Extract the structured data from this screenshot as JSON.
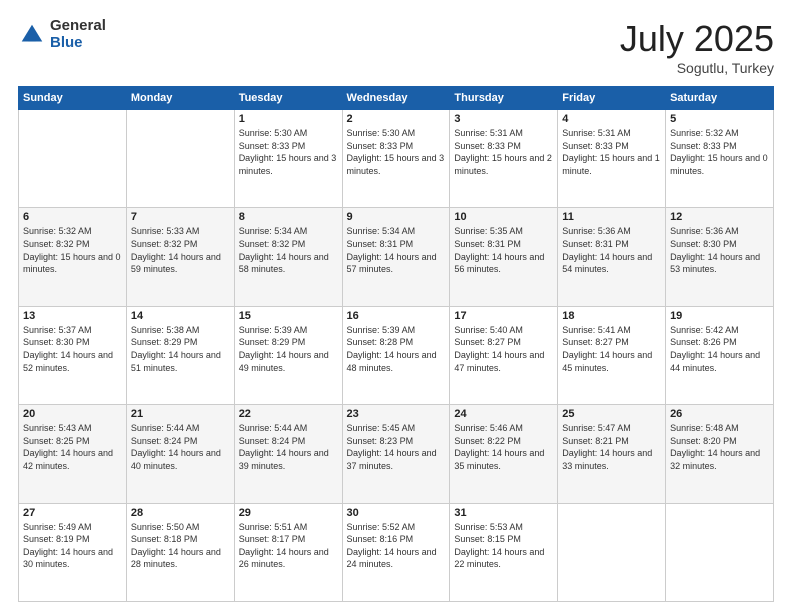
{
  "logo": {
    "general": "General",
    "blue": "Blue"
  },
  "header": {
    "month": "July 2025",
    "location": "Sogutlu, Turkey"
  },
  "weekdays": [
    "Sunday",
    "Monday",
    "Tuesday",
    "Wednesday",
    "Thursday",
    "Friday",
    "Saturday"
  ],
  "weeks": [
    [
      {
        "day": "",
        "sunrise": "",
        "sunset": "",
        "daylight": ""
      },
      {
        "day": "",
        "sunrise": "",
        "sunset": "",
        "daylight": ""
      },
      {
        "day": "1",
        "sunrise": "Sunrise: 5:30 AM",
        "sunset": "Sunset: 8:33 PM",
        "daylight": "Daylight: 15 hours and 3 minutes."
      },
      {
        "day": "2",
        "sunrise": "Sunrise: 5:30 AM",
        "sunset": "Sunset: 8:33 PM",
        "daylight": "Daylight: 15 hours and 3 minutes."
      },
      {
        "day": "3",
        "sunrise": "Sunrise: 5:31 AM",
        "sunset": "Sunset: 8:33 PM",
        "daylight": "Daylight: 15 hours and 2 minutes."
      },
      {
        "day": "4",
        "sunrise": "Sunrise: 5:31 AM",
        "sunset": "Sunset: 8:33 PM",
        "daylight": "Daylight: 15 hours and 1 minute."
      },
      {
        "day": "5",
        "sunrise": "Sunrise: 5:32 AM",
        "sunset": "Sunset: 8:33 PM",
        "daylight": "Daylight: 15 hours and 0 minutes."
      }
    ],
    [
      {
        "day": "6",
        "sunrise": "Sunrise: 5:32 AM",
        "sunset": "Sunset: 8:32 PM",
        "daylight": "Daylight: 15 hours and 0 minutes."
      },
      {
        "day": "7",
        "sunrise": "Sunrise: 5:33 AM",
        "sunset": "Sunset: 8:32 PM",
        "daylight": "Daylight: 14 hours and 59 minutes."
      },
      {
        "day": "8",
        "sunrise": "Sunrise: 5:34 AM",
        "sunset": "Sunset: 8:32 PM",
        "daylight": "Daylight: 14 hours and 58 minutes."
      },
      {
        "day": "9",
        "sunrise": "Sunrise: 5:34 AM",
        "sunset": "Sunset: 8:31 PM",
        "daylight": "Daylight: 14 hours and 57 minutes."
      },
      {
        "day": "10",
        "sunrise": "Sunrise: 5:35 AM",
        "sunset": "Sunset: 8:31 PM",
        "daylight": "Daylight: 14 hours and 56 minutes."
      },
      {
        "day": "11",
        "sunrise": "Sunrise: 5:36 AM",
        "sunset": "Sunset: 8:31 PM",
        "daylight": "Daylight: 14 hours and 54 minutes."
      },
      {
        "day": "12",
        "sunrise": "Sunrise: 5:36 AM",
        "sunset": "Sunset: 8:30 PM",
        "daylight": "Daylight: 14 hours and 53 minutes."
      }
    ],
    [
      {
        "day": "13",
        "sunrise": "Sunrise: 5:37 AM",
        "sunset": "Sunset: 8:30 PM",
        "daylight": "Daylight: 14 hours and 52 minutes."
      },
      {
        "day": "14",
        "sunrise": "Sunrise: 5:38 AM",
        "sunset": "Sunset: 8:29 PM",
        "daylight": "Daylight: 14 hours and 51 minutes."
      },
      {
        "day": "15",
        "sunrise": "Sunrise: 5:39 AM",
        "sunset": "Sunset: 8:29 PM",
        "daylight": "Daylight: 14 hours and 49 minutes."
      },
      {
        "day": "16",
        "sunrise": "Sunrise: 5:39 AM",
        "sunset": "Sunset: 8:28 PM",
        "daylight": "Daylight: 14 hours and 48 minutes."
      },
      {
        "day": "17",
        "sunrise": "Sunrise: 5:40 AM",
        "sunset": "Sunset: 8:27 PM",
        "daylight": "Daylight: 14 hours and 47 minutes."
      },
      {
        "day": "18",
        "sunrise": "Sunrise: 5:41 AM",
        "sunset": "Sunset: 8:27 PM",
        "daylight": "Daylight: 14 hours and 45 minutes."
      },
      {
        "day": "19",
        "sunrise": "Sunrise: 5:42 AM",
        "sunset": "Sunset: 8:26 PM",
        "daylight": "Daylight: 14 hours and 44 minutes."
      }
    ],
    [
      {
        "day": "20",
        "sunrise": "Sunrise: 5:43 AM",
        "sunset": "Sunset: 8:25 PM",
        "daylight": "Daylight: 14 hours and 42 minutes."
      },
      {
        "day": "21",
        "sunrise": "Sunrise: 5:44 AM",
        "sunset": "Sunset: 8:24 PM",
        "daylight": "Daylight: 14 hours and 40 minutes."
      },
      {
        "day": "22",
        "sunrise": "Sunrise: 5:44 AM",
        "sunset": "Sunset: 8:24 PM",
        "daylight": "Daylight: 14 hours and 39 minutes."
      },
      {
        "day": "23",
        "sunrise": "Sunrise: 5:45 AM",
        "sunset": "Sunset: 8:23 PM",
        "daylight": "Daylight: 14 hours and 37 minutes."
      },
      {
        "day": "24",
        "sunrise": "Sunrise: 5:46 AM",
        "sunset": "Sunset: 8:22 PM",
        "daylight": "Daylight: 14 hours and 35 minutes."
      },
      {
        "day": "25",
        "sunrise": "Sunrise: 5:47 AM",
        "sunset": "Sunset: 8:21 PM",
        "daylight": "Daylight: 14 hours and 33 minutes."
      },
      {
        "day": "26",
        "sunrise": "Sunrise: 5:48 AM",
        "sunset": "Sunset: 8:20 PM",
        "daylight": "Daylight: 14 hours and 32 minutes."
      }
    ],
    [
      {
        "day": "27",
        "sunrise": "Sunrise: 5:49 AM",
        "sunset": "Sunset: 8:19 PM",
        "daylight": "Daylight: 14 hours and 30 minutes."
      },
      {
        "day": "28",
        "sunrise": "Sunrise: 5:50 AM",
        "sunset": "Sunset: 8:18 PM",
        "daylight": "Daylight: 14 hours and 28 minutes."
      },
      {
        "day": "29",
        "sunrise": "Sunrise: 5:51 AM",
        "sunset": "Sunset: 8:17 PM",
        "daylight": "Daylight: 14 hours and 26 minutes."
      },
      {
        "day": "30",
        "sunrise": "Sunrise: 5:52 AM",
        "sunset": "Sunset: 8:16 PM",
        "daylight": "Daylight: 14 hours and 24 minutes."
      },
      {
        "day": "31",
        "sunrise": "Sunrise: 5:53 AM",
        "sunset": "Sunset: 8:15 PM",
        "daylight": "Daylight: 14 hours and 22 minutes."
      },
      {
        "day": "",
        "sunrise": "",
        "sunset": "",
        "daylight": ""
      },
      {
        "day": "",
        "sunrise": "",
        "sunset": "",
        "daylight": ""
      }
    ]
  ]
}
